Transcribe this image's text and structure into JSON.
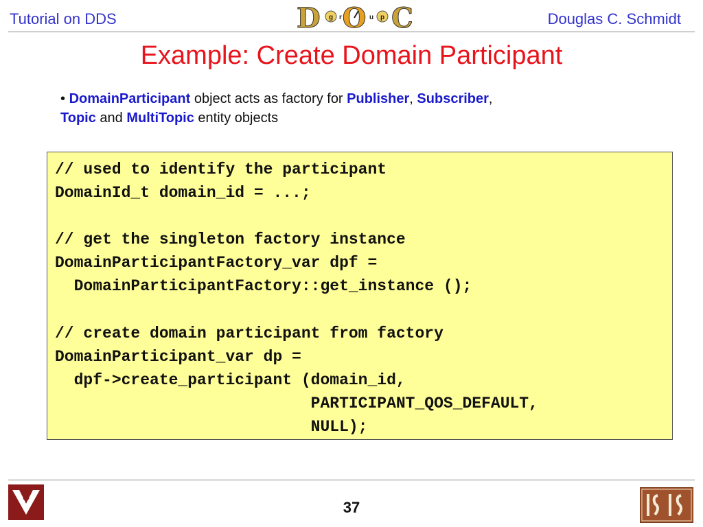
{
  "header": {
    "left_text": "Tutorial on DDS",
    "right_text": "Douglas C. Schmidt",
    "logo_letters": {
      "d": "D",
      "g": "g",
      "r": "r",
      "o": "O",
      "u": "u",
      "p": "p",
      "c": "C"
    }
  },
  "slide": {
    "title": "Example: Create Domain Participant",
    "bullet": {
      "marker": "•",
      "kw1": "DomainParticipant",
      "t1": " object acts as factory for ",
      "kw2": "Publisher",
      "t2": ", ",
      "kw3": "Subscriber",
      "t3": ",",
      "kw4": "Topic",
      "t4": " and ",
      "kw5": "MultiTopic",
      "t5": " entity objects"
    },
    "code_lines": [
      "// used to identify the participant",
      "DomainId_t domain_id = ...;",
      "",
      "// get the singleton factory instance",
      "DomainParticipantFactory_var dpf =",
      "  DomainParticipantFactory::get_instance ();",
      "",
      "// create domain participant from factory",
      "DomainParticipant_var dp =",
      "  dpf->create_participant (domain_id,",
      "                           PARTICIPANT_QOS_DEFAULT,",
      "                           NULL);"
    ]
  },
  "footer": {
    "page_number": "37"
  },
  "colors": {
    "header_text": "#3333cc",
    "title": "#e8141c",
    "keyword": "#1a1acc",
    "code_background": "#ffff99",
    "logo_maroon": "#8b1a1a"
  }
}
